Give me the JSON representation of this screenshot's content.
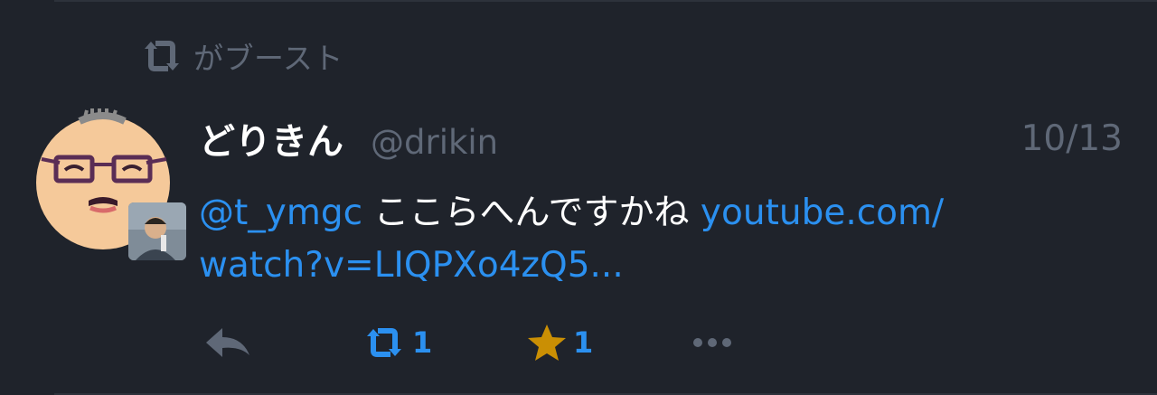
{
  "boost": {
    "icon": "retweet-icon",
    "text": "がブースト"
  },
  "status": {
    "avatar_icon": "cartoon-face-avatar",
    "display_name": "どりきん",
    "handle": "@drikin",
    "timestamp": "10/13",
    "content": {
      "mention": "@t_ymgc",
      "text": " ここらへんですかね ",
      "link_line1": "youtube.com/",
      "link_line2": "watch?v=LIQPXo4zQ5..."
    }
  },
  "actions": {
    "reply_icon": "reply-icon",
    "reblog_icon": "retweet-icon",
    "reblog_count": "1",
    "favourite_icon": "star-icon",
    "favourite_count": "1",
    "more_icon": "ellipsis-icon"
  },
  "colors": {
    "background": "#1f232b",
    "muted": "#5f6877",
    "link": "#2b90f0",
    "reblog_active": "#2b90f0",
    "favourite_active": "#ca8f04"
  }
}
